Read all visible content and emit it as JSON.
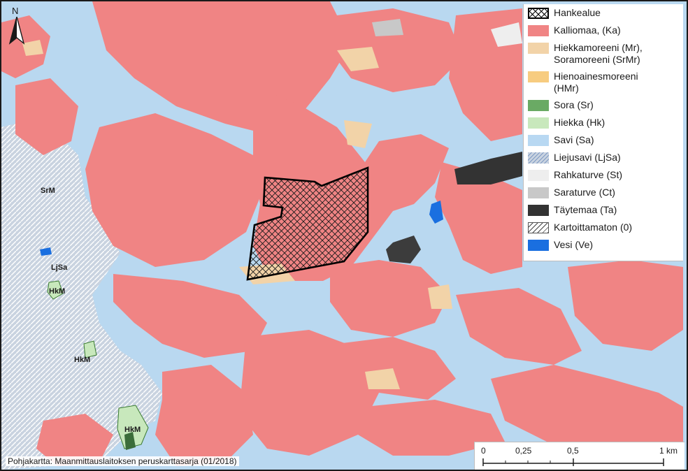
{
  "map": {
    "north_letter": "N",
    "north_icon": "north-arrow-icon",
    "place_labels": [
      "SrM",
      "LjSa",
      "HkM",
      "HkM",
      "HkM"
    ],
    "credit": "Pohjakartta: Maanmittauslaitoksen peruskarttasarja (01/2018)"
  },
  "legend": {
    "items": [
      {
        "label": "Hankealue",
        "pattern": "crosshatch-outline",
        "color": "#000000"
      },
      {
        "label": "Kalliomaa, (Ka)",
        "pattern": "fill",
        "color": "#f08484"
      },
      {
        "label": "Hiekkamoreeni (Mr),\nSoramoreeni (SrMr)",
        "pattern": "fill",
        "color": "#f2d3a8"
      },
      {
        "label": "Hienoainesmoreeni\n(HMr)",
        "pattern": "fill",
        "color": "#f7cc80"
      },
      {
        "label": "Sora (Sr)",
        "pattern": "fill",
        "color": "#6aaa64"
      },
      {
        "label": "Hiekka (Hk)",
        "pattern": "fill",
        "color": "#c8e8bc"
      },
      {
        "label": "Savi (Sa)",
        "pattern": "fill",
        "color": "#b8d8f2"
      },
      {
        "label": "Liejusavi (LjSa)",
        "pattern": "diagonal",
        "color": "#9fb8d8"
      },
      {
        "label": "Rahkaturve (St)",
        "pattern": "fill",
        "color": "#eeeeee"
      },
      {
        "label": "Saraturve (Ct)",
        "pattern": "fill",
        "color": "#c8c8c8"
      },
      {
        "label": "Täytemaa (Ta)",
        "pattern": "fill",
        "color": "#333333"
      },
      {
        "label": "Kartoittamaton (0)",
        "pattern": "hatch",
        "color": "#000000"
      },
      {
        "label": "Vesi (Ve)",
        "pattern": "fill",
        "color": "#1a6fe0"
      }
    ]
  },
  "scalebar": {
    "ticks": [
      "0",
      "0,25",
      "0,5",
      "1 km"
    ]
  }
}
